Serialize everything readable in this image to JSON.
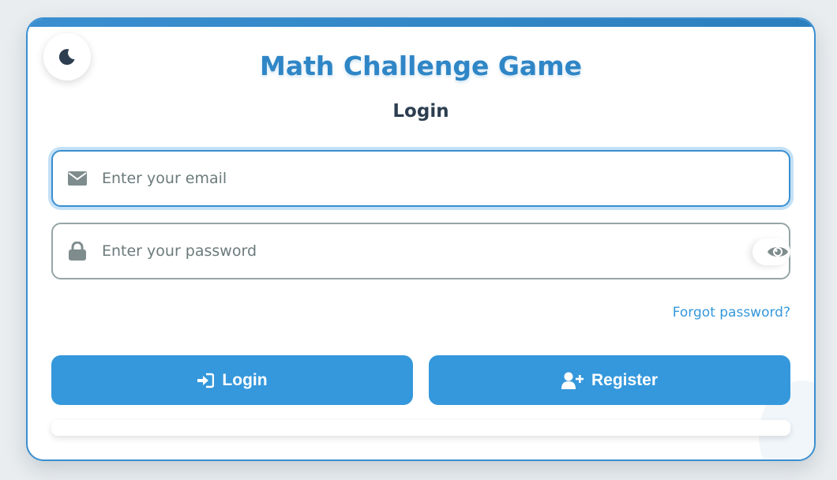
{
  "app": {
    "title": "Math Challenge Game"
  },
  "form": {
    "heading": "Login",
    "email": {
      "placeholder": "Enter your email",
      "value": ""
    },
    "password": {
      "placeholder": "Enter your password",
      "value": ""
    },
    "forgot_label": "Forgot password?"
  },
  "buttons": {
    "login_label": "Login",
    "register_label": "Register"
  },
  "icons": {
    "theme": "moon-icon",
    "email": "envelope-icon",
    "password": "lock-icon",
    "visibility": "eye-icon",
    "login": "sign-in-icon",
    "register": "user-plus-icon"
  },
  "colors": {
    "accent": "#3498db",
    "title": "#2f86c6",
    "border_active": "#3a8fd0",
    "border_idle": "#95a5a6",
    "icon": "#7f8c8d",
    "text": "#2c3e50"
  }
}
